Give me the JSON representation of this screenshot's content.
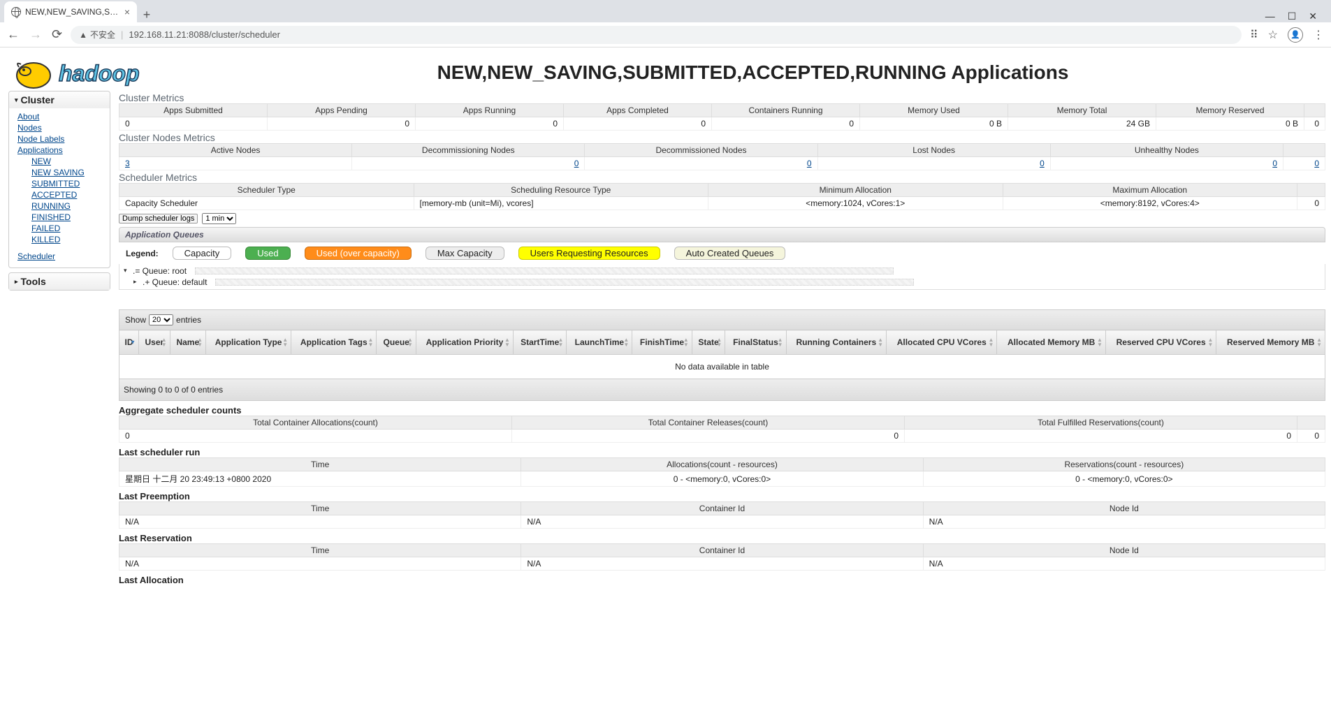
{
  "chrome": {
    "tabTitle": "NEW,NEW_SAVING,SUBMITTE",
    "secureText": "不安全",
    "url": "192.168.11.21:8088/cluster/scheduler"
  },
  "header": {
    "title": "NEW,NEW_SAVING,SUBMITTED,ACCEPTED,RUNNING Applications",
    "logoText": "hadoop"
  },
  "sidebar": {
    "panel1": {
      "title": "Cluster",
      "links": [
        "About",
        "Nodes",
        "Node Labels",
        "Applications"
      ],
      "sublinks": [
        "NEW",
        "NEW SAVING",
        "SUBMITTED",
        "ACCEPTED",
        "RUNNING",
        "FINISHED",
        "FAILED",
        "KILLED"
      ],
      "scheduler": "Scheduler"
    },
    "panel2": {
      "title": "Tools"
    }
  },
  "clusterMetrics": {
    "title": "Cluster Metrics",
    "headers": [
      "Apps Submitted",
      "Apps Pending",
      "Apps Running",
      "Apps Completed",
      "Containers Running",
      "Memory Used",
      "Memory Total",
      "Memory Reserved",
      ""
    ],
    "values": [
      "0",
      "0",
      "0",
      "0",
      "0",
      "0 B",
      "24 GB",
      "0 B",
      "0"
    ]
  },
  "nodesMetrics": {
    "title": "Cluster Nodes Metrics",
    "headers": [
      "Active Nodes",
      "Decommissioning Nodes",
      "Decommissioned Nodes",
      "Lost Nodes",
      "Unhealthy Nodes",
      ""
    ],
    "values": [
      "3",
      "0",
      "0",
      "0",
      "0",
      "0"
    ]
  },
  "schedMetrics": {
    "title": "Scheduler Metrics",
    "headers": [
      "Scheduler Type",
      "Scheduling Resource Type",
      "Minimum Allocation",
      "Maximum Allocation",
      ""
    ],
    "values": [
      "Capacity Scheduler",
      "[memory-mb (unit=Mi), vcores]",
      "<memory:1024, vCores:1>",
      "<memory:8192, vCores:4>",
      "0"
    ]
  },
  "dump": {
    "btn": "Dump scheduler logs",
    "period": "1 min"
  },
  "queues": {
    "title": "Application Queues",
    "legend": "Legend:",
    "items": [
      "Capacity",
      "Used",
      "Used (over capacity)",
      "Max Capacity",
      "Users Requesting Resources",
      "Auto Created Queues"
    ],
    "tree": [
      ".= Queue: root",
      ".+ Queue: default"
    ]
  },
  "apps": {
    "showPrefix": "Show",
    "showSuffix": "entries",
    "pageSize": "20",
    "headers": [
      "ID",
      "User",
      "Name",
      "Application Type",
      "Application Tags",
      "Queue",
      "Application Priority",
      "StartTime",
      "LaunchTime",
      "FinishTime",
      "State",
      "FinalStatus",
      "Running Containers",
      "Allocated CPU VCores",
      "Allocated Memory MB",
      "Reserved CPU VCores",
      "Reserved Memory MB"
    ],
    "empty": "No data available in table",
    "footer": "Showing 0 to 0 of 0 entries"
  },
  "agg": {
    "title": "Aggregate scheduler counts",
    "headers": [
      "Total Container Allocations(count)",
      "Total Container Releases(count)",
      "Total Fulfilled Reservations(count)",
      ""
    ],
    "values": [
      "0",
      "0",
      "0",
      "0"
    ]
  },
  "lastRun": {
    "title": "Last scheduler run",
    "headers": [
      "Time",
      "Allocations(count - resources)",
      "Reservations(count - resources)"
    ],
    "values": [
      "星期日 十二月 20 23:49:13 +0800 2020",
      "0 - <memory:0, vCores:0>",
      "0 - <memory:0, vCores:0>"
    ]
  },
  "lastPre": {
    "title": "Last Preemption",
    "headers": [
      "Time",
      "Container Id",
      "Node Id"
    ],
    "values": [
      "N/A",
      "N/A",
      "N/A"
    ]
  },
  "lastRes": {
    "title": "Last Reservation",
    "headers": [
      "Time",
      "Container Id",
      "Node Id"
    ],
    "values": [
      "N/A",
      "N/A",
      "N/A"
    ]
  },
  "lastAlloc": {
    "title": "Last Allocation"
  }
}
